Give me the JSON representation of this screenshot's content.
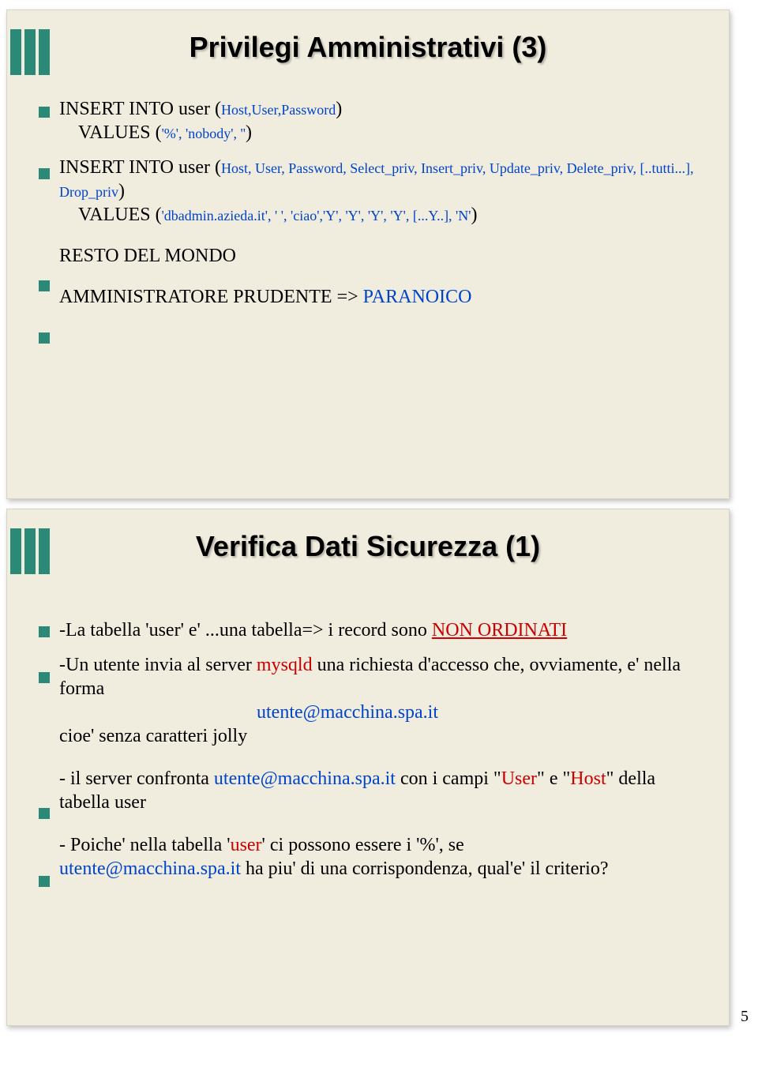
{
  "page_number": "5",
  "slide1": {
    "title": "Privilegi Amministrativi (3)",
    "line1a": "INSERT INTO user (",
    "line1b": "Host,User,Password",
    "line1c": ")",
    "line2a": "VALUES (",
    "line2b": "'%', 'nobody', ''",
    "line2c": ")",
    "line3a": "INSERT INTO user (",
    "line3b": "Host, User, Password, Select_priv, Insert_priv, Update_priv, Delete_priv, [..tutti...], Drop_priv",
    "line3c": ")",
    "line4a": "VALUES (",
    "line4b": "'dbadmin.azieda.it', '  ', 'ciao','Y', 'Y', 'Y', 'Y', [...Y..], 'N'",
    "line4c": ")",
    "line5": "RESTO DEL MONDO",
    "line6a": "AMMINISTRATORE PRUDENTE => ",
    "line6b": "PARANOICO"
  },
  "slide2": {
    "title": "Verifica Dati Sicurezza (1)",
    "p1a": "-La tabella 'user' e' ...una tabella=> i record sono ",
    "p1b": "NON ORDINATI",
    "p2a": "-Un utente invia al server ",
    "p2b": "mysqld",
    "p2c": " una richiesta d'accesso che, ovviamente, e' nella forma",
    "p2d": "utente@macchina.spa.it",
    "p2e": "cioe' senza caratteri jolly",
    "p3a": "- il server confronta ",
    "p3b": "utente@macchina.spa.it",
    "p3c": " con i campi \"",
    "p3d": "User",
    "p3e": "\" e \"",
    "p3f": "Host",
    "p3g": "\" della tabella user",
    "p4a": "- Poiche' nella tabella '",
    "p4b": "user",
    "p4c": "' ci possono essere i '%', se ",
    "p4d": "utente@macchina.spa.it",
    "p4e": " ha piu' di una corrispondenza, qual'e' il criterio?"
  }
}
